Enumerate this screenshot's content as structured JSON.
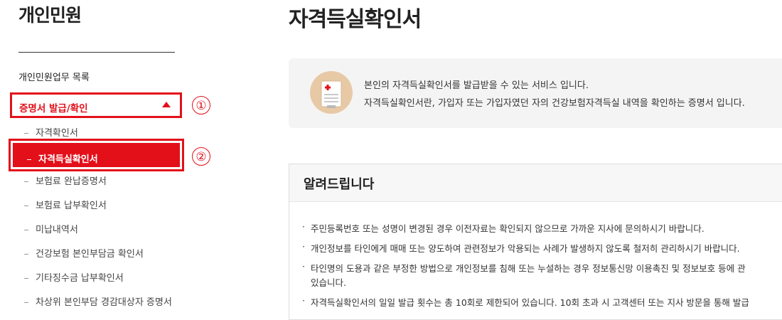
{
  "sidebar": {
    "title": "개인민원",
    "menu_list_label": "개인민원업무 목록",
    "group_label": "증명서 발급/확인",
    "annotation_1": "①",
    "annotation_2": "②",
    "items": [
      {
        "label": "자격확인서"
      },
      {
        "label": "자격득실확인서"
      },
      {
        "label": "보험료 완납증명서"
      },
      {
        "label": "보험료 납부확인서"
      },
      {
        "label": "미납내역서"
      },
      {
        "label": "건강보험 본인부담금 확인서"
      },
      {
        "label": "기타징수금 납부확인서"
      },
      {
        "label": "차상위 본인부담 경감대상자 증명서"
      }
    ]
  },
  "main": {
    "page_title": "자격득실확인서",
    "intro_lines": [
      "본인의 자격득실확인서를 발급받을 수 있는 서비스 입니다.",
      "자격득실확인서란, 가입자 또는 가입자였던 자의 건강보험자격득실 내역을 확인하는 증명서 입니다."
    ],
    "notice_title": "알려드립니다",
    "notice_items": [
      "주민등록번호 또는 성명이 변경된 경우 이전자료는 확인되지 않으므로 가까운 지사에 문의하시기 바랍니다.",
      "개인정보를 타인에게 매매 또는 양도하여 관련정보가 악용되는 사례가 발생하지 않도록 철저히 관리하시기 바랍니다.",
      "타인명의 도용과 같은 부정한 방법으로 개인정보를 침해 또는 누설하는 경우 정보통신망 이용촉진 및 정보보호 등에 관",
      "있습니다.",
      "자격득실확인서의 일일 발급 횟수는 총 10회로 제한되어 있습니다. 10회 초과 시 고객센터 또는 지사 방문을 통해 발급"
    ]
  },
  "colors": {
    "accent": "#e3101a",
    "info_bg": "#f4f4f4"
  }
}
